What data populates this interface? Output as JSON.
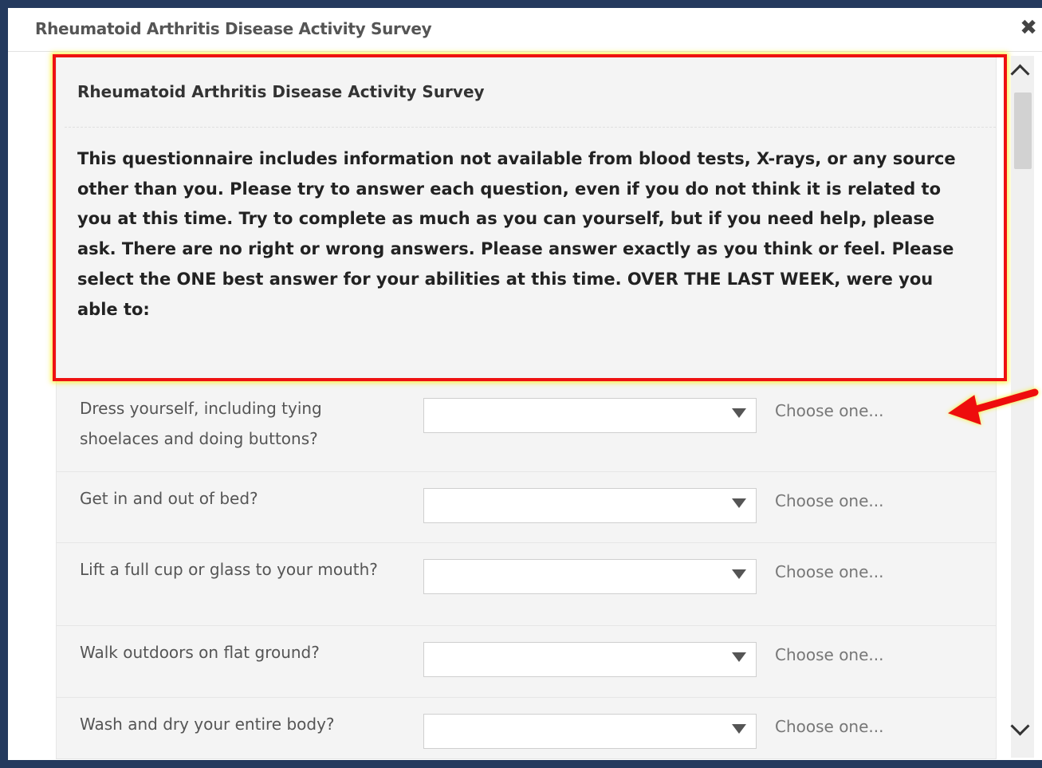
{
  "dialog": {
    "title": "Rheumatoid Arthritis Disease Activity Survey",
    "close_icon": "close-icon"
  },
  "survey": {
    "heading": "Rheumatoid Arthritis Disease Activity Survey",
    "instructions": "This questionnaire includes information not available from blood tests, X-rays, or any source other than you. Please try to answer each question, even if you do not think it is related to you at this time. Try to complete as much as you can yourself, but if you need help, please ask. There are no right or wrong answers. Please answer exactly as you think or feel. Please select the ONE best answer for your abilities at this time. OVER THE LAST WEEK, were you able to:",
    "questions": [
      {
        "label": "Dress yourself, including tying shoelaces and doing buttons?",
        "value": "",
        "hint": "Choose one..."
      },
      {
        "label": "Get in and out of bed?",
        "value": "",
        "hint": "Choose one..."
      },
      {
        "label": "Lift a full cup or glass to your mouth?",
        "value": "",
        "hint": "Choose one..."
      },
      {
        "label": "Walk outdoors on flat ground?",
        "value": "",
        "hint": "Choose one..."
      },
      {
        "label": "Wash and dry your entire body?",
        "value": "",
        "hint": "Choose one..."
      }
    ]
  },
  "annotation": {
    "highlight_color": "#ee1111",
    "glow_color": "#f5ee28",
    "arrow_color": "#ee1111"
  }
}
